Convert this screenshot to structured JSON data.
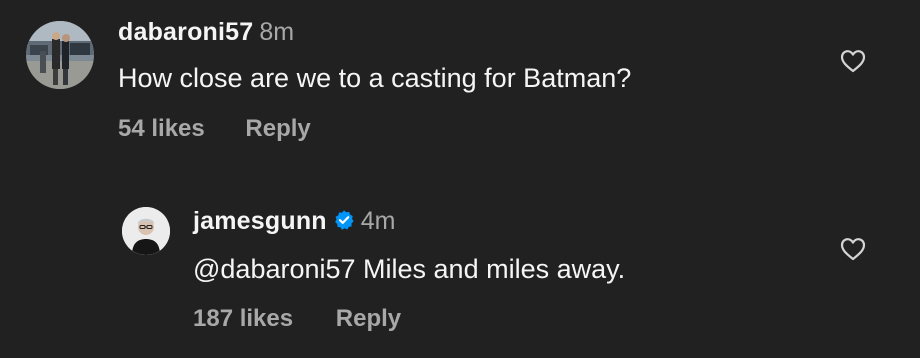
{
  "comments": [
    {
      "username": "dabaroni57",
      "time": "8m",
      "text": "How close are we to a casting for Batman?",
      "likes": "54 likes",
      "reply_label": "Reply",
      "like_icon": "heart-outline-icon"
    },
    {
      "username": "jamesgunn",
      "verified": true,
      "verified_icon": "verified-badge-icon",
      "time": "4m",
      "mention": "@dabaroni57",
      "text": " Miles and miles away.",
      "likes": "187 likes",
      "reply_label": "Reply",
      "like_icon": "heart-outline-icon"
    }
  ],
  "colors": {
    "background": "#212121",
    "primary_text": "#f5f5f5",
    "secondary_text": "#a8a8a8",
    "verified_blue": "#0095f6"
  }
}
